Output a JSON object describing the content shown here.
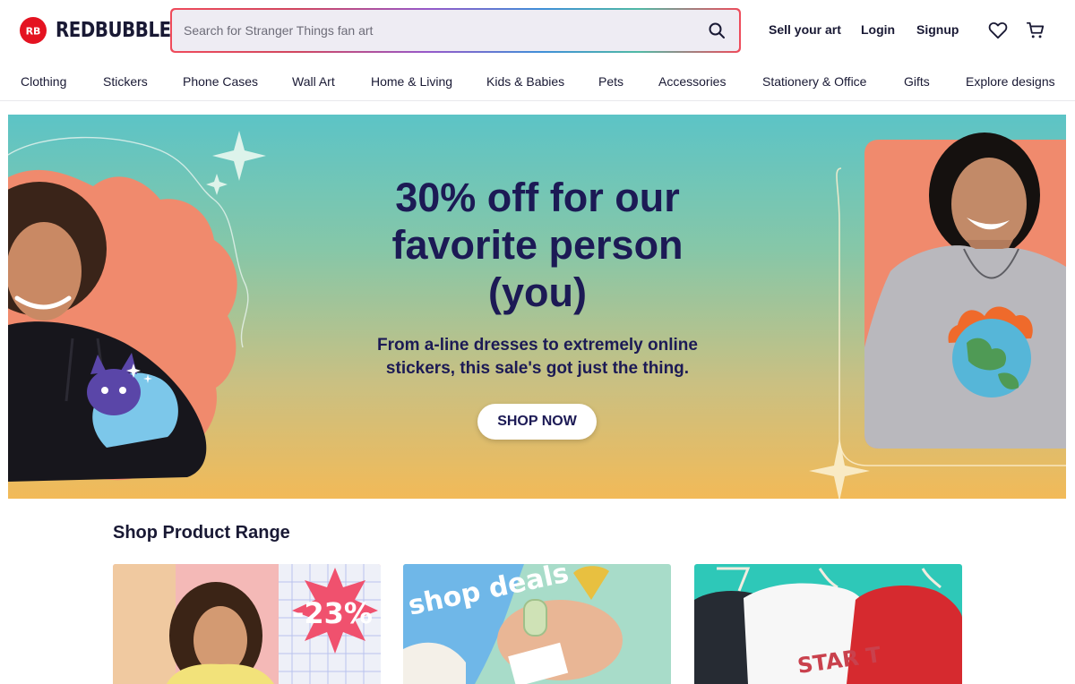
{
  "brand": {
    "name": "REDBUBBLE",
    "badge_text": "RB",
    "color": "#e41321"
  },
  "search": {
    "placeholder": "Search for Stranger Things fan art",
    "value": "",
    "icon": "search-icon"
  },
  "header": {
    "sell": "Sell your art",
    "login": "Login",
    "signup": "Signup",
    "wishlist_icon": "heart-icon",
    "cart_icon": "cart-icon"
  },
  "nav": {
    "items": [
      "Clothing",
      "Stickers",
      "Phone Cases",
      "Wall Art",
      "Home & Living",
      "Kids & Babies",
      "Pets",
      "Accessories",
      "Stationery & Office",
      "Gifts",
      "Explore designs"
    ]
  },
  "hero": {
    "title": "30% off for our favorite person (you)",
    "subtitle": "From a-line dresses to extremely online stickers, this sale's got just the thing.",
    "cta": "SHOP NOW"
  },
  "product_range": {
    "title": "Shop Product Range",
    "cards": [
      {
        "badge": "-23%"
      },
      {
        "badge": "shop deals"
      },
      {
        "badge": "STAR T"
      }
    ]
  },
  "colors": {
    "text": "#191934",
    "hero_text": "#1c1a55",
    "accent": "#e41321"
  }
}
